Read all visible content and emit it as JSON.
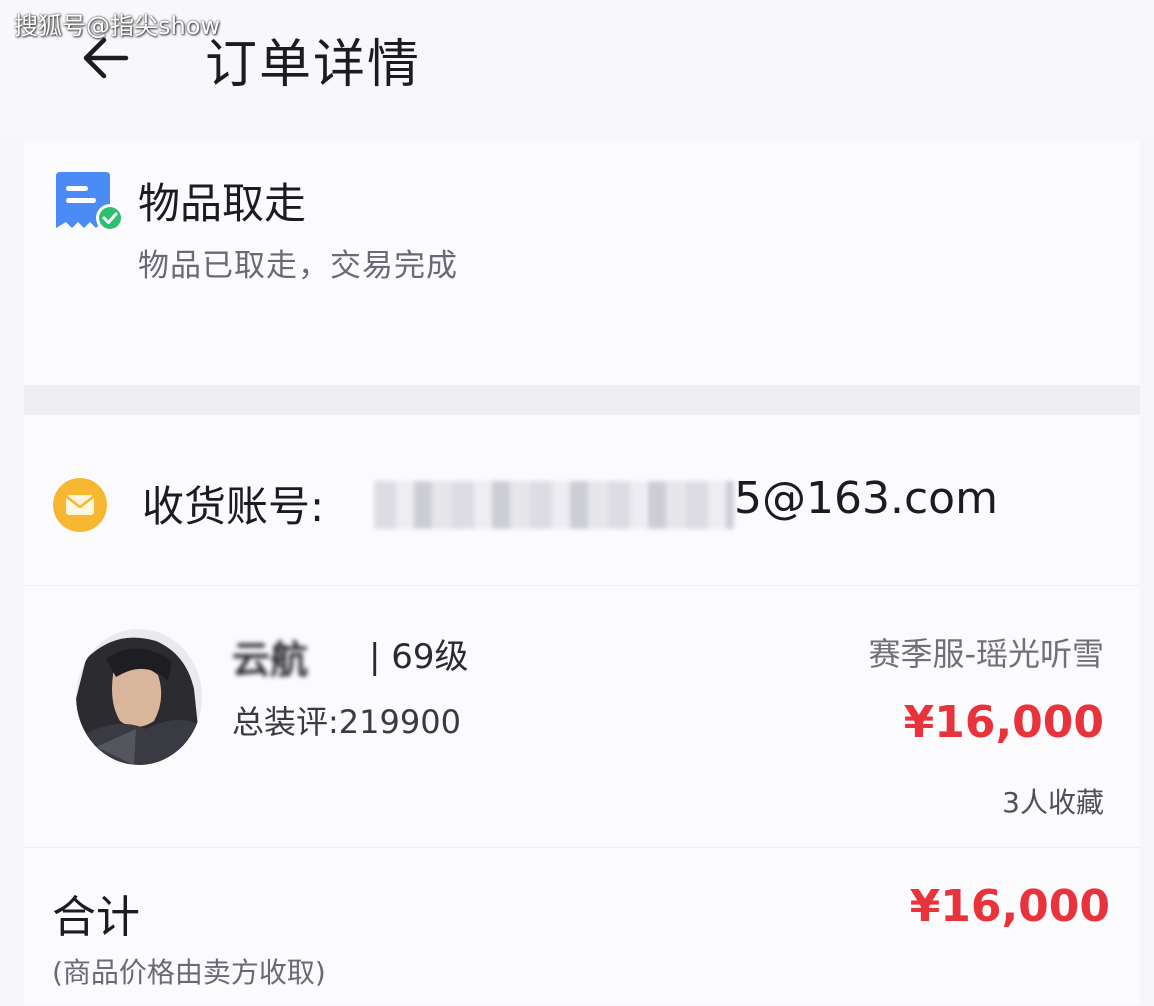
{
  "watermark": "搜狐号@指尖show",
  "header": {
    "title": "订单详情"
  },
  "status": {
    "title": "物品取走",
    "description": "物品已取走，交易完成"
  },
  "account": {
    "label": "收货账号:",
    "value_visible": "5@163.com"
  },
  "item": {
    "name_blurred": "云航",
    "level": "| 69级",
    "score": "总装评:219900",
    "server": "赛季服-瑶光听雪",
    "price": "¥16,000",
    "favorites": "3人收藏"
  },
  "total": {
    "label": "合计",
    "price": "¥16,000",
    "note": "(商品价格由卖方收取)"
  },
  "colors": {
    "accent_red": "#e8333c",
    "status_icon_blue": "#4a8bf5",
    "status_check_green": "#2fbf71",
    "mail_icon_orange": "#f7b731"
  },
  "icons": [
    "back-arrow-icon",
    "order-status-icon",
    "checkmark-icon",
    "mail-icon",
    "avatar"
  ]
}
